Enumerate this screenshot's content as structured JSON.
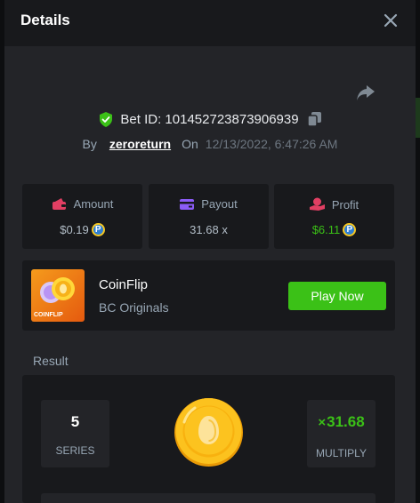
{
  "header": {
    "title": "Details"
  },
  "bet": {
    "id_label": "Bet ID: 101452723873906939",
    "by_label": "By",
    "username": "zeroreturn",
    "on_label": "On",
    "datetime": "12/13/2022, 6:47:26 AM"
  },
  "stats": {
    "amount": {
      "label": "Amount",
      "value": "$0.19",
      "icon": "wallet-icon",
      "color": "#e23f63"
    },
    "payout": {
      "label": "Payout",
      "value": "31.68 x",
      "icon": "card-icon",
      "color": "#8b5cf6"
    },
    "profit": {
      "label": "Profit",
      "value": "$6.11",
      "icon": "hand-coin-icon",
      "color": "#e23f63",
      "value_color": "#3bc117"
    }
  },
  "game": {
    "thumb_label": "COINFLIP",
    "name": "CoinFlip",
    "provider": "BC Originals",
    "play_label": "Play Now"
  },
  "result": {
    "label": "Result",
    "series_value": "5",
    "series_label": "SERIES",
    "multiply_prefix": "×",
    "multiply_value": "31.68",
    "multiply_label": "MULTIPLY"
  },
  "colors": {
    "accent_green": "#3bc117",
    "panel": "#18191c",
    "dialog": "#232428",
    "muted_text": "#98a7b5"
  }
}
